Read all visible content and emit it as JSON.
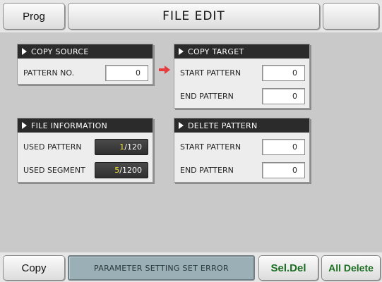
{
  "header": {
    "prog_label": "Prog",
    "title": "FILE EDIT",
    "right_button_label": ""
  },
  "copy_source": {
    "heading": "COPY SOURCE",
    "pattern_no_label": "PATTERN NO.",
    "pattern_no_value": "0"
  },
  "copy_target": {
    "heading": "COPY TARGET",
    "start_label": "START PATTERN",
    "start_value": "0",
    "end_label": "END PATTERN",
    "end_value": "0"
  },
  "file_information": {
    "heading": "FILE INFORMATION",
    "used_pattern_label": "USED PATTERN",
    "used_pattern_current": "1",
    "used_pattern_total": "/120",
    "used_segment_label": "USED SEGMENT",
    "used_segment_current": "5",
    "used_segment_total": "/1200"
  },
  "delete_pattern": {
    "heading": "DELETE PATTERN",
    "start_label": "START PATTERN",
    "start_value": "0",
    "end_label": "END PATTERN",
    "end_value": "0"
  },
  "footer": {
    "copy_label": "Copy",
    "status_message": "PARAMETER SETTING SET ERROR",
    "sel_del_label": "Sel.Del",
    "all_delete_label": "All Delete"
  },
  "colors": {
    "arrow": "#e8393b",
    "panel_header": "#2b2b2b",
    "status_bg": "#9bb0b6",
    "delete_button_text": "#1b6e21",
    "used_current_value": "#f2e23a"
  },
  "icons": {
    "panel_heading_marker": "triangle-right-icon",
    "copy_direction": "right-arrow-icon"
  }
}
